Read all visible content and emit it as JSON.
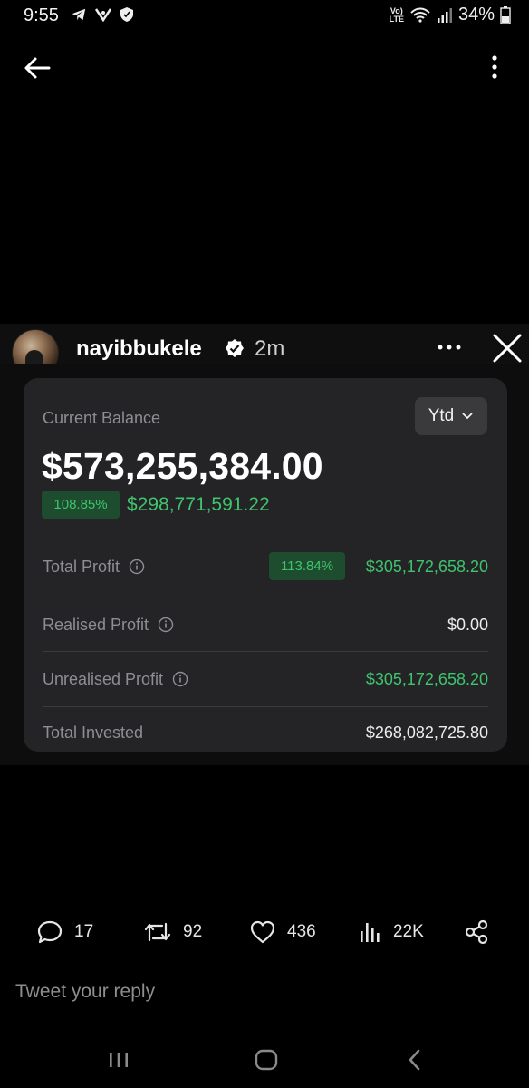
{
  "status_bar": {
    "time": "9:55",
    "battery": "34%",
    "network": "VoLTE"
  },
  "post": {
    "username": "nayibbukele",
    "time": "2m"
  },
  "card": {
    "current_balance_label": "Current Balance",
    "period": "Ytd",
    "balance": "$573,255,384.00",
    "change_percent": "108.85%",
    "change_amount": "$298,771,591.22",
    "rows": [
      {
        "label": "Total Profit",
        "badge": "113.84%",
        "value": "$305,172,658.20"
      },
      {
        "label": "Realised Profit",
        "value": "$0.00"
      },
      {
        "label": "Unrealised Profit",
        "value": "$305,172,658.20"
      },
      {
        "label": "Total Invested",
        "value": "$268,082,725.80"
      }
    ]
  },
  "actions": {
    "replies": "17",
    "retweets": "92",
    "likes": "436",
    "views": "22K"
  },
  "reply_placeholder": "Tweet your reply",
  "colors": {
    "green": "#3ec46d",
    "card_bg": "#242426",
    "badge_bg": "#1d4d2e"
  },
  "icons": [
    "telegram-icon",
    "vpn-icon",
    "shield-icon",
    "wifi-icon",
    "signal-icon",
    "battery-icon",
    "back-arrow-icon",
    "more-vertical-icon",
    "verified-icon",
    "more-horizontal-icon",
    "close-icon",
    "info-icon",
    "chevron-down-icon",
    "reply-icon",
    "retweet-icon",
    "heart-icon",
    "views-icon",
    "share-icon",
    "recents-icon",
    "home-icon",
    "back-nav-icon"
  ]
}
